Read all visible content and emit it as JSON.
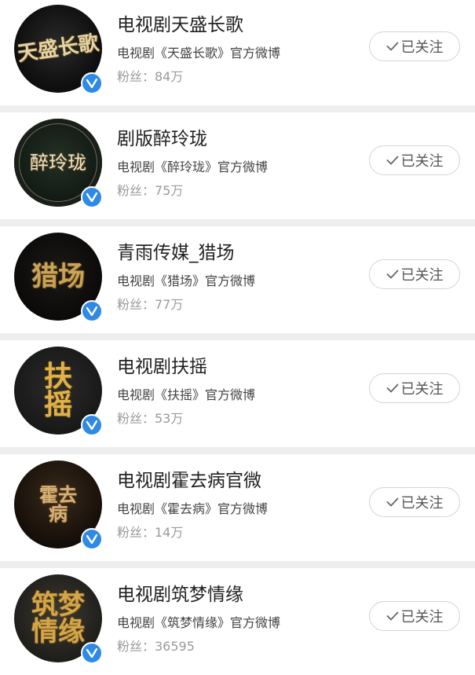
{
  "accounts": [
    {
      "name": "电视剧天盛长歌",
      "desc": "电视剧《天盛长歌》官方微博",
      "fans": "粉丝：84万",
      "avatar_text": "天盛长歌",
      "follow_label": "已关注"
    },
    {
      "name": "剧版醉玲珑",
      "desc": "电视剧《醉玲珑》官方微博",
      "fans": "粉丝：75万",
      "avatar_text": "醉玲珑",
      "follow_label": "已关注"
    },
    {
      "name": "青雨传媒_猎场",
      "desc": "电视剧《猎场》官方微博",
      "fans": "粉丝：77万",
      "avatar_text": "猎场",
      "follow_label": "已关注"
    },
    {
      "name": "电视剧扶摇",
      "desc": "电视剧《扶摇》官方微博",
      "fans": "粉丝：53万",
      "avatar_text": "扶摇",
      "follow_label": "已关注"
    },
    {
      "name": "电视剧霍去病官微",
      "desc": "电视剧《霍去病》官方微博",
      "fans": "粉丝：14万",
      "avatar_text": "霍去病",
      "follow_label": "已关注"
    },
    {
      "name": "电视剧筑梦情缘",
      "desc": "电视剧《筑梦情缘》官方微博",
      "fans": "粉丝：36595",
      "avatar_text": "筑梦情缘",
      "follow_label": "已关注"
    }
  ],
  "colors": {
    "verified_badge": "#2f8ae5",
    "avatar_gold": "#d9b56a"
  },
  "icons": {
    "verified": "verified-v-icon",
    "follow_check": "check-icon"
  }
}
